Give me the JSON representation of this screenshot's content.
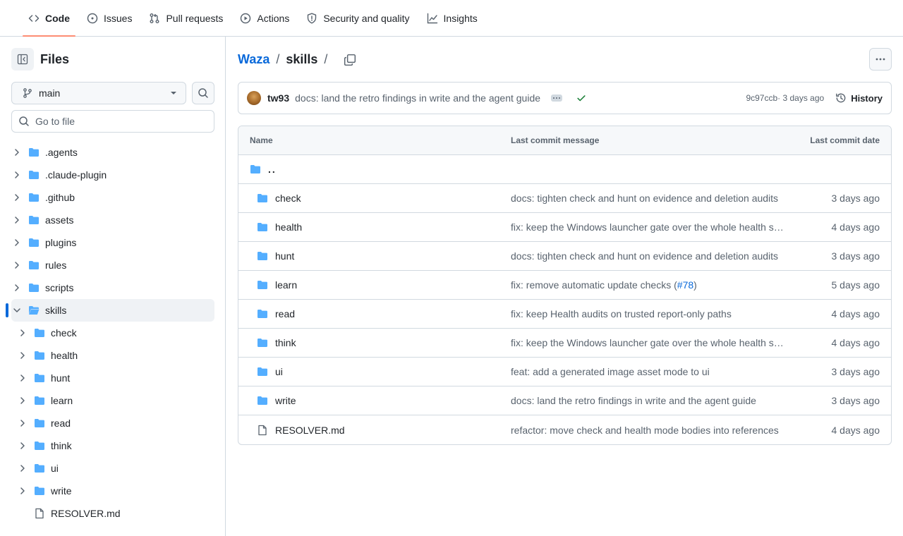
{
  "nav": {
    "tabs": [
      {
        "label": "Code",
        "icon": "code-icon",
        "active": true
      },
      {
        "label": "Issues",
        "icon": "issue-icon",
        "active": false
      },
      {
        "label": "Pull requests",
        "icon": "pull-request-icon",
        "active": false
      },
      {
        "label": "Actions",
        "icon": "play-icon",
        "active": false
      },
      {
        "label": "Security and quality",
        "icon": "shield-icon",
        "active": false
      },
      {
        "label": "Insights",
        "icon": "graph-icon",
        "active": false
      }
    ]
  },
  "sidebar": {
    "title": "Files",
    "branch": "main",
    "search_placeholder": "Go to file",
    "tree": [
      {
        "label": ".agents",
        "type": "folder"
      },
      {
        "label": ".claude-plugin",
        "type": "folder"
      },
      {
        "label": ".github",
        "type": "folder"
      },
      {
        "label": "assets",
        "type": "folder"
      },
      {
        "label": "plugins",
        "type": "folder"
      },
      {
        "label": "rules",
        "type": "folder"
      },
      {
        "label": "scripts",
        "type": "folder"
      },
      {
        "label": "skills",
        "type": "folder-open",
        "selected": true
      },
      {
        "label": "check",
        "type": "folder",
        "level": 1
      },
      {
        "label": "health",
        "type": "folder",
        "level": 1
      },
      {
        "label": "hunt",
        "type": "folder",
        "level": 1
      },
      {
        "label": "learn",
        "type": "folder",
        "level": 1
      },
      {
        "label": "read",
        "type": "folder",
        "level": 1
      },
      {
        "label": "think",
        "type": "folder",
        "level": 1
      },
      {
        "label": "ui",
        "type": "folder",
        "level": 1
      },
      {
        "label": "write",
        "type": "folder",
        "level": 1
      },
      {
        "label": "RESOLVER.md",
        "type": "file",
        "level": 1
      }
    ]
  },
  "breadcrumb": {
    "repo": "Waza",
    "sep": "/",
    "current": "skills"
  },
  "commit": {
    "author": "tw93",
    "message": "docs: land the retro findings in write and the agent guide",
    "sha": "9c97ccb",
    "time": " · 3 days ago",
    "history_label": "History"
  },
  "table": {
    "headers": {
      "name": "Name",
      "message": "Last commit message",
      "date": "Last commit date"
    },
    "parent": "..",
    "rows": [
      {
        "name": "check",
        "type": "folder",
        "message": "docs: tighten check and hunt on evidence and deletion audits",
        "date": "3 days ago"
      },
      {
        "name": "health",
        "type": "folder",
        "message": "fix: keep the Windows launcher gate over the whole health s…",
        "date": "4 days ago"
      },
      {
        "name": "hunt",
        "type": "folder",
        "message": "docs: tighten check and hunt on evidence and deletion audits",
        "date": "3 days ago"
      },
      {
        "name": "learn",
        "type": "folder",
        "message": "fix: remove automatic update checks (",
        "pr": "#78",
        "message_end": ")",
        "date": "5 days ago"
      },
      {
        "name": "read",
        "type": "folder",
        "message": "fix: keep Health audits on trusted report-only paths",
        "date": "4 days ago"
      },
      {
        "name": "think",
        "type": "folder",
        "message": "fix: keep the Windows launcher gate over the whole health s…",
        "date": "4 days ago"
      },
      {
        "name": "ui",
        "type": "folder",
        "message": "feat: add a generated image asset mode to ui",
        "date": "3 days ago"
      },
      {
        "name": "write",
        "type": "folder",
        "message": "docs: land the retro findings in write and the agent guide",
        "date": "3 days ago"
      },
      {
        "name": "RESOLVER.md",
        "type": "file",
        "message": "refactor: move check and health mode bodies into references",
        "date": "4 days ago"
      }
    ]
  },
  "colors": {
    "accent": "#0969da",
    "folder": "#54aeff",
    "active_underline": "#fd8c73",
    "success": "#1a7f37"
  }
}
